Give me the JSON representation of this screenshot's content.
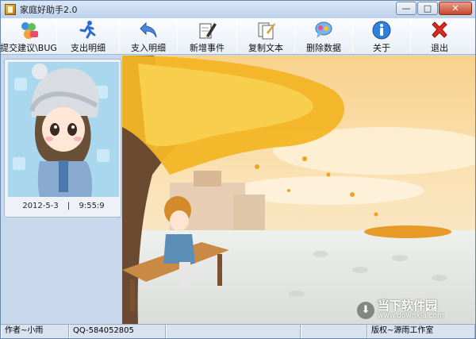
{
  "window": {
    "title": "家庭好助手2.0"
  },
  "toolbar": {
    "items": [
      {
        "label": "提交建议\\BUG",
        "icon": "users-chat-icon"
      },
      {
        "label": "支出明细",
        "icon": "running-man-icon"
      },
      {
        "label": "支入明细",
        "icon": "back-arrow-icon"
      },
      {
        "label": "新增事件",
        "icon": "pencil-notebook-icon"
      },
      {
        "label": "复制文本",
        "icon": "copy-document-icon"
      },
      {
        "label": "删除数据",
        "icon": "delete-data-icon"
      },
      {
        "label": "关于",
        "icon": "info-icon"
      },
      {
        "label": "退出",
        "icon": "red-x-icon"
      }
    ]
  },
  "sidebar": {
    "date": "2012-5-3",
    "time": "9:55:9"
  },
  "statusbar": {
    "author": "作者~小雨",
    "qq": "QQ-584052805",
    "copyright": "版权~源雨工作室"
  },
  "watermark": {
    "text": "当下软件园",
    "url": "www.downxia.com"
  },
  "colors": {
    "accent": "#3a6fb0",
    "close_red": "#c5452a"
  }
}
